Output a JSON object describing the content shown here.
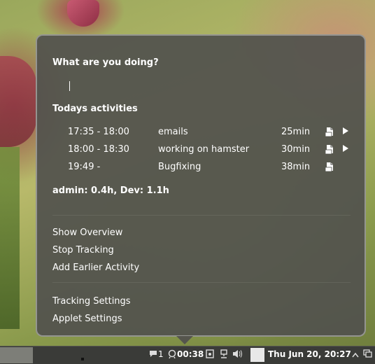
{
  "popup": {
    "question": "What are you doing?",
    "input_value": "",
    "activities_heading": "Todays activities",
    "activities": [
      {
        "time": "17:35 - 18:00",
        "name": "emails",
        "duration": "25min",
        "has_play": true
      },
      {
        "time": "18:00 - 18:30",
        "name": "working on hamster",
        "duration": "30min",
        "has_play": true
      },
      {
        "time": "19:49 -",
        "name": "Bugfixing",
        "duration": "38min",
        "has_play": false
      }
    ],
    "totals": "admin: 0.4h, Dev: 1.1h",
    "menu_group_1": [
      "Show Overview",
      "Stop Tracking",
      "Add Earlier Activity"
    ],
    "menu_group_2": [
      "Tracking Settings",
      "Applet Settings"
    ]
  },
  "panel": {
    "chat_count": "1",
    "timer": "00:38",
    "clock": "Thu Jun 20, 20:27",
    "icons": [
      "chat-icon",
      "hamster-icon",
      "clipboard-icon",
      "network-icon",
      "volume-icon",
      "chevron-up-icon",
      "window-list-icon"
    ]
  },
  "colors": {
    "popup_bg": "#52524e",
    "panel_bg": "#3a3b38",
    "text": "#ffffff"
  }
}
